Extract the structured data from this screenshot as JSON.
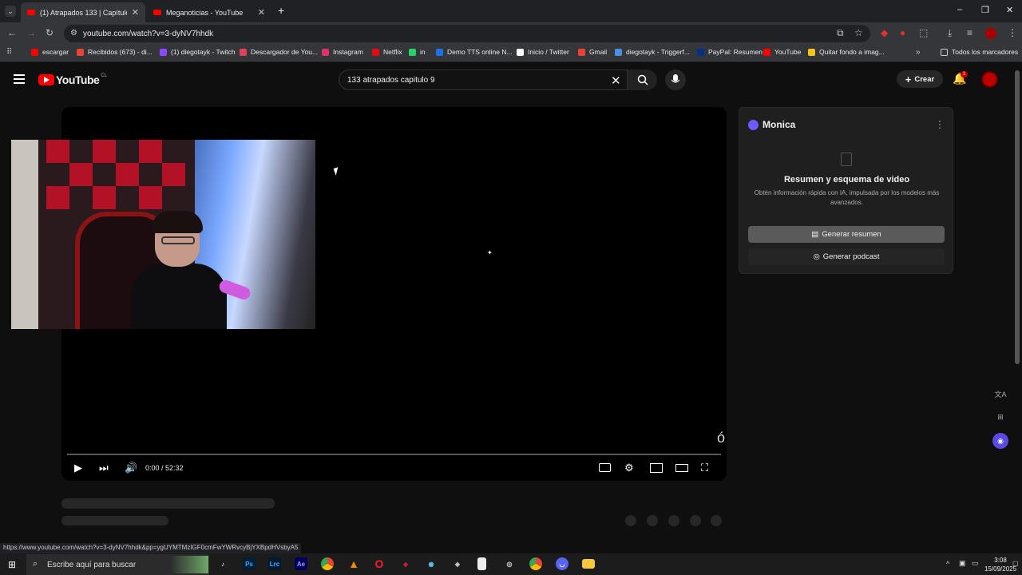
{
  "browser": {
    "tabs": [
      {
        "title": "(1) Atrapados 133 | Capítulo",
        "active": true
      },
      {
        "title": "Meganoticias - YouTube",
        "active": false
      }
    ],
    "new_tab": "+",
    "url": "youtube.com/watch?v=3-dyNV7hhdk",
    "bookmarks": [
      {
        "label": "escargar",
        "color": "#ff0000"
      },
      {
        "label": "Recibidos (673) - di...",
        "color": "#ea4335"
      },
      {
        "label": "(1) diegotayk - Twitch",
        "color": "#9146ff"
      },
      {
        "label": "Descargador de You...",
        "color": "#e04060"
      },
      {
        "label": "Instagram",
        "color": "#e1306c"
      },
      {
        "label": "Netflix",
        "color": "#e50914"
      },
      {
        "label": "in",
        "color": "#25d366"
      },
      {
        "label": "Demo TTS online N...",
        "color": "#1a73e8"
      },
      {
        "label": "Inicio / Twitter",
        "color": "#ffffff"
      },
      {
        "label": "Gmail",
        "color": "#ea4335"
      },
      {
        "label": "diegotayk - Triggerf...",
        "color": "#4a90e2"
      },
      {
        "label": "PayPal: Resumen",
        "color": "#003087"
      },
      {
        "label": "YouTube",
        "color": "#ff0000"
      },
      {
        "label": "Quitar fondo a imag...",
        "color": "#f5c518"
      }
    ],
    "all_bookmarks": "Todos los marcadores"
  },
  "youtube": {
    "logo_text": "YouTube",
    "country": "CL",
    "search_value": "133 atrapados capitulo 9",
    "create_label": "Crear",
    "notif_count": "1"
  },
  "player": {
    "time": "0:00 / 52:32",
    "progress": 0
  },
  "monica": {
    "title": "Monica",
    "heading": "Resumen y esquema de video",
    "description": "Obtén información rápida con IA, impulsada por los modelos más avanzados.",
    "summary_button": "Generar resumen",
    "podcast_button": "Generar podcast"
  },
  "status_url": "https://www.youtube.com/watch?v=3-dyNV7hhdk&pp=ygUYMTMzIGF0cmFwYWRvcyBjYXBpdHVsbyA5",
  "taskbar": {
    "search_placeholder": "Escribe aquí para buscar",
    "apps": [
      {
        "label": "Ps",
        "color": "#001e36",
        "fg": "#31a8ff"
      },
      {
        "label": "Lrc",
        "color": "#001a33",
        "fg": "#4ab4ff"
      },
      {
        "label": "Ae",
        "color": "#00005b",
        "fg": "#9999ff"
      }
    ],
    "time": "3:08",
    "date": "15/09/2025"
  }
}
